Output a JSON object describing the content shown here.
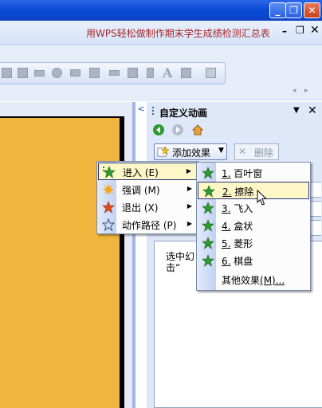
{
  "window": {
    "minimize_glyph": "_",
    "restore_glyph": "❐",
    "close_glyph": "✕"
  },
  "document": {
    "title": "用WPS轻松做制作期末学生成绩检测汇总表",
    "min_glyph": "–",
    "restore_glyph": "❐",
    "close_glyph": "✕"
  },
  "toolbar": {
    "text_icon": "A",
    "scroll_left": "◂",
    "scroll_right": "▸"
  },
  "task_pane": {
    "collapse_glyph": "<",
    "title": "自定义动画",
    "dropdown_glyph": "▼",
    "close_glyph": "✕",
    "add_effect_label": "添加效果",
    "add_effect_dd": "▼",
    "delete_label": "删除",
    "delete_glyph": "✕",
    "hint": "选中幻击“"
  },
  "effects_menu": {
    "items": [
      {
        "label": "进入",
        "key": "(E)",
        "icon": "green-star-icon",
        "highlighted": true
      },
      {
        "label": "强调",
        "key": "(M)",
        "icon": "sun-burst-icon",
        "highlighted": false
      },
      {
        "label": "退出",
        "key": "(X)",
        "icon": "red-star-icon",
        "highlighted": false
      },
      {
        "label": "动作路径",
        "key": "(P)",
        "icon": "outline-star-icon",
        "highlighted": false
      }
    ],
    "arrow_glyph": "▶"
  },
  "entrance_menu": {
    "items": [
      {
        "num": "1.",
        "label": "百叶窗",
        "highlighted": false
      },
      {
        "num": "2.",
        "label": "擦除",
        "highlighted": true
      },
      {
        "num": "3.",
        "label": "飞入",
        "highlighted": false
      },
      {
        "num": "4.",
        "label": "盒状",
        "highlighted": false
      },
      {
        "num": "5.",
        "label": "菱形",
        "highlighted": false
      },
      {
        "num": "6.",
        "label": "棋盘",
        "highlighted": false
      }
    ],
    "more_label": "其他效果",
    "more_key": "(M)...",
    "icon": "green-star-icon"
  },
  "colors": {
    "title_bar": "#0a4bd6",
    "slide": "#f0b53c",
    "doc_title": "#a82626",
    "highlight": "#fdf6c6",
    "star_green": "#2f9a2f"
  }
}
